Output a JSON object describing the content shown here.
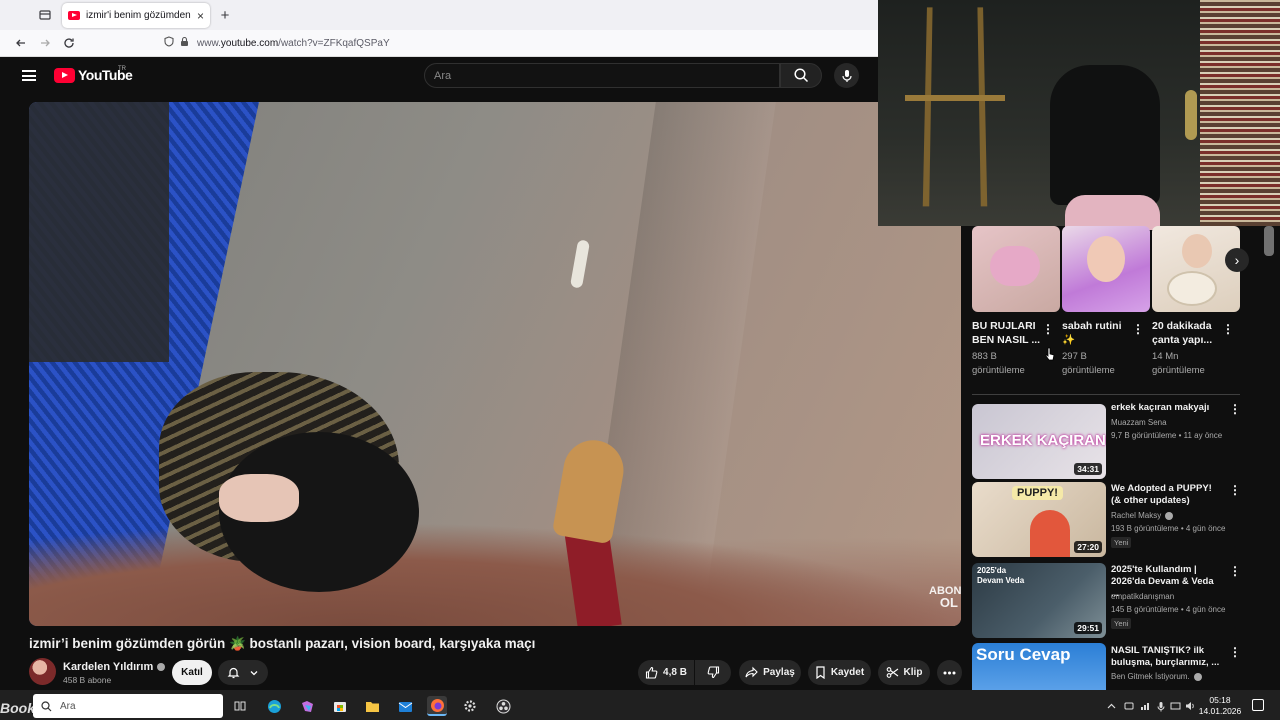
{
  "browser": {
    "tab_title": "izmir'i benim gözümden görün",
    "tab_close": "×",
    "new_tab": "+",
    "url_prefix": "www.",
    "url_host": "youtube.com",
    "url_path": "/watch?v=ZFKqafQSPaY"
  },
  "youtube": {
    "logo_text": "YouTube",
    "logo_region": "TR",
    "search_placeholder": "Ara"
  },
  "video": {
    "watermark_line1": "ABONE",
    "watermark_line2": "OL",
    "title": "izmir’i benim gözümden görün 🪴 bostanlı pazarı, vision board, karşıyaka maçı",
    "channel_name": "Kardelen Yıldırım",
    "subscribers": "458 B abone",
    "join_label": "Katıl",
    "like_count": "4,8 B",
    "share_label": "Paylaş",
    "save_label": "Kaydet",
    "clip_label": "Klip"
  },
  "shelf": [
    {
      "title": "BU RUJLARI BEN NASIL ...",
      "views": "883 B",
      "views_suffix": "görüntüleme"
    },
    {
      "title": "sabah rutini ✨",
      "views": "297 B",
      "views_suffix": "görüntüleme"
    },
    {
      "title": "20 dakikada çanta yapı...",
      "views": "14 Mn",
      "views_suffix": "görüntüleme"
    }
  ],
  "recommendations": [
    {
      "title": "erkek kaçıran makyajı",
      "channel": "Muazzam Sena",
      "meta": "9,7 B görüntüleme • 11 ay önce",
      "duration": "34:31",
      "thumb_text": "ERKEK KAÇIRAN",
      "new": ""
    },
    {
      "title": "We Adopted a PUPPY! (& other updates)",
      "channel": "Rachel Maksy",
      "meta": "193 B görüntüleme • 4 gün önce",
      "duration": "27:20",
      "thumb_text": "PUPPY!",
      "new": "Yeni"
    },
    {
      "title": "2025'te Kullandım | 2026'da Devam & Veda ...",
      "channel": "empatikdanışman",
      "meta": "145 B görüntüleme • 4 gün önce",
      "duration": "29:51",
      "thumb_text": "2025'da Devam Veda",
      "new": "Yeni"
    },
    {
      "title": "NASIL TANIŞTIK? ilk buluşma, burçlarımız, ...",
      "channel": "Ben Gitmek İstiyorum.",
      "meta": "",
      "duration": "",
      "thumb_text": "Soru Cevap",
      "new": ""
    }
  ],
  "taskbar": {
    "search_placeholder": "Ara",
    "time": "05:18",
    "date": "14.01.2026",
    "overlay_brand": "BookTime"
  },
  "colors": {
    "yt_red": "#ff0033",
    "bg": "#0f0f0f",
    "chip": "#272727"
  }
}
